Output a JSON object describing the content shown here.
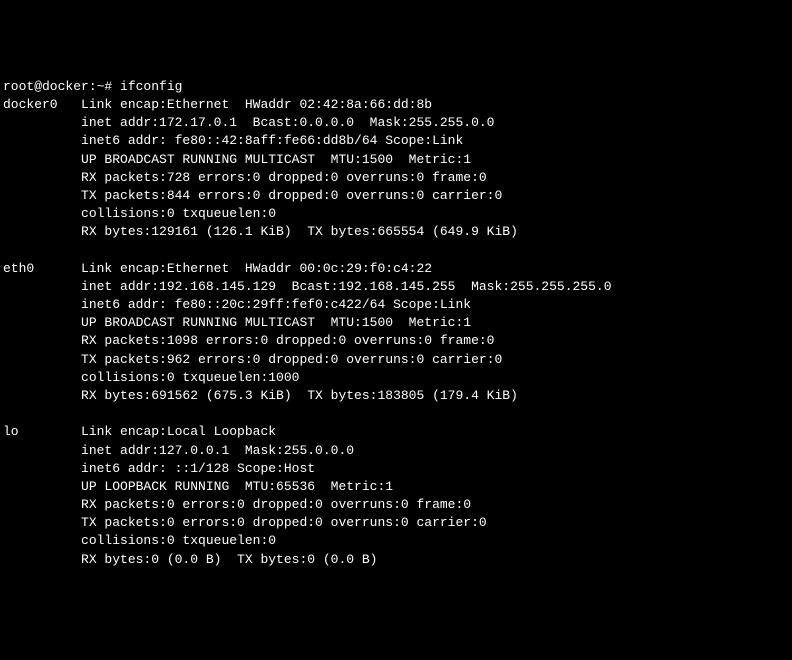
{
  "prompt": "root@docker:~# ",
  "command": "ifconfig",
  "interfaces": [
    {
      "name": "docker0",
      "lines": [
        "Link encap:Ethernet  HWaddr 02:42:8a:66:dd:8b",
        "inet addr:172.17.0.1  Bcast:0.0.0.0  Mask:255.255.0.0",
        "inet6 addr: fe80::42:8aff:fe66:dd8b/64 Scope:Link",
        "UP BROADCAST RUNNING MULTICAST  MTU:1500  Metric:1",
        "RX packets:728 errors:0 dropped:0 overruns:0 frame:0",
        "TX packets:844 errors:0 dropped:0 overruns:0 carrier:0",
        "collisions:0 txqueuelen:0",
        "RX bytes:129161 (126.1 KiB)  TX bytes:665554 (649.9 KiB)"
      ]
    },
    {
      "name": "eth0",
      "lines": [
        "Link encap:Ethernet  HWaddr 00:0c:29:f0:c4:22",
        "inet addr:192.168.145.129  Bcast:192.168.145.255  Mask:255.255.255.0",
        "inet6 addr: fe80::20c:29ff:fef0:c422/64 Scope:Link",
        "UP BROADCAST RUNNING MULTICAST  MTU:1500  Metric:1",
        "RX packets:1098 errors:0 dropped:0 overruns:0 frame:0",
        "TX packets:962 errors:0 dropped:0 overruns:0 carrier:0",
        "collisions:0 txqueuelen:1000",
        "RX bytes:691562 (675.3 KiB)  TX bytes:183805 (179.4 KiB)"
      ]
    },
    {
      "name": "lo",
      "lines": [
        "Link encap:Local Loopback",
        "inet addr:127.0.0.1  Mask:255.0.0.0",
        "inet6 addr: ::1/128 Scope:Host",
        "UP LOOPBACK RUNNING  MTU:65536  Metric:1",
        "RX packets:0 errors:0 dropped:0 overruns:0 frame:0",
        "TX packets:0 errors:0 dropped:0 overruns:0 carrier:0",
        "collisions:0 txqueuelen:0",
        "RX bytes:0 (0.0 B)  TX bytes:0 (0.0 B)"
      ]
    }
  ]
}
